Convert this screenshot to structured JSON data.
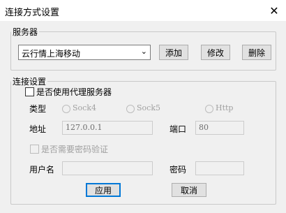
{
  "window": {
    "title": "连接方式设置",
    "close_glyph": "✕"
  },
  "server_group": {
    "title": "服务器",
    "selected_server": "云行情上海移动",
    "dropdown_glyph": "⌄",
    "add_label": "添加",
    "edit_label": "修改",
    "delete_label": "删除"
  },
  "connection_group": {
    "title": "连接设置",
    "use_proxy": {
      "label": "是否使用代理服务器",
      "checked": false
    },
    "type_label": "类型",
    "types": [
      "Sock4",
      "Sock5",
      "Http"
    ],
    "address_label": "地址",
    "address_value": "127.0.0.1",
    "port_label": "端口",
    "port_value": "80",
    "need_password": {
      "label": "是否需要密码验证",
      "checked": false
    },
    "username_label": "用户名",
    "username_value": "",
    "password_label": "密码",
    "password_value": ""
  },
  "footer": {
    "apply_label": "应用",
    "cancel_label": "取消"
  }
}
